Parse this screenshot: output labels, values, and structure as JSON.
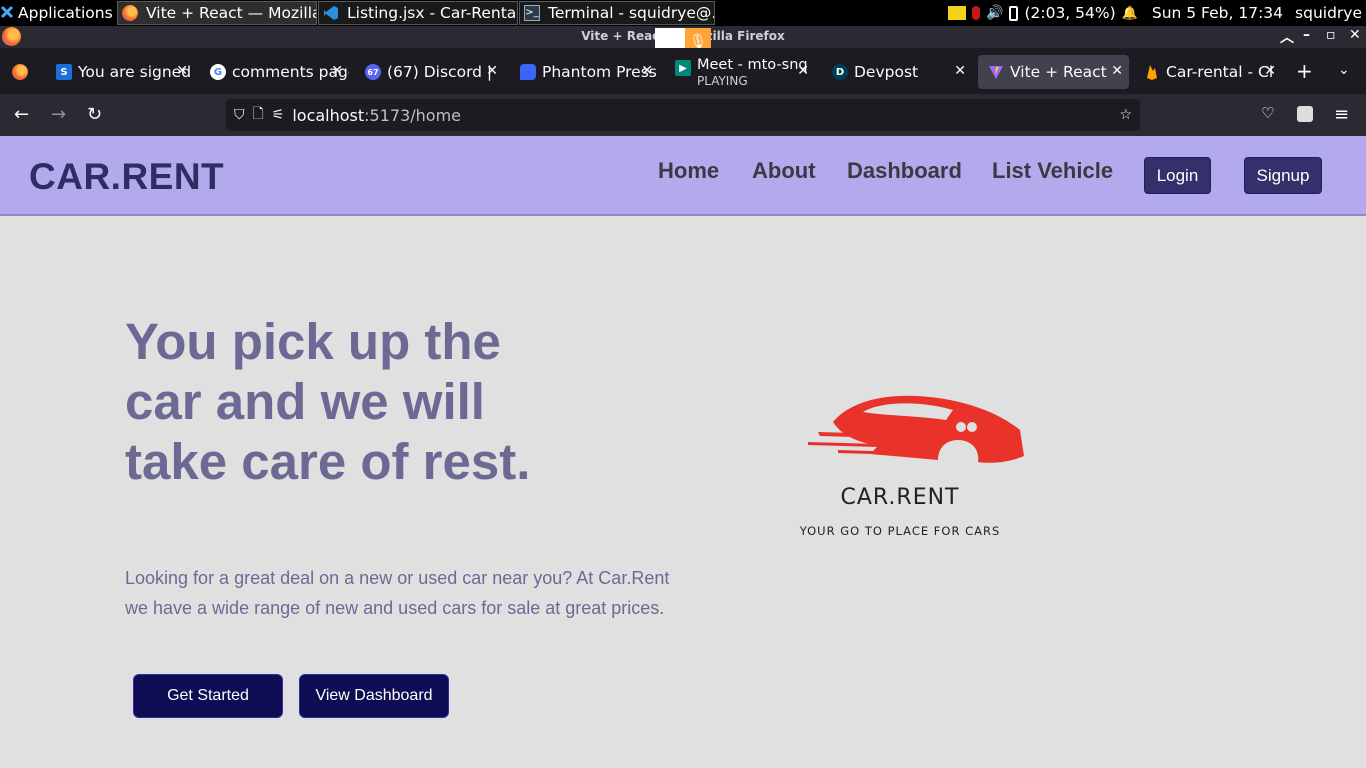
{
  "taskbar": {
    "apps_label": "Applications",
    "windows": [
      {
        "label": "Vite + React — Mozilla..."
      },
      {
        "label": "Listing.jsx - Car-Rental..."
      },
      {
        "label": "Terminal - squidrye@..."
      }
    ],
    "battery": "(2:03, 54%)",
    "clock": "Sun  5 Feb, 17:34",
    "user": "squidrye"
  },
  "browser": {
    "window_title": "Vite + React — Mozilla Firefox",
    "tabs": [
      {
        "label": "You are signed",
        "icon": "s-icon",
        "color": "#1b6fd8"
      },
      {
        "label": "comments page",
        "icon": "google-icon",
        "color": "#ffffff"
      },
      {
        "label": "(67) Discord |",
        "icon": "discord-icon",
        "color": "#5865f2"
      },
      {
        "label": "Phantom Press",
        "icon": "phantom-icon",
        "color": "#3b66f5"
      },
      {
        "label": "Meet - mto-snq",
        "sub": "PLAYING",
        "icon": "meet-icon",
        "color": "#00897b"
      },
      {
        "label": "Devpost",
        "icon": "devpost-icon",
        "color": "#003e54"
      },
      {
        "label": "Vite + React",
        "icon": "vite-icon",
        "color": "#9b6cff"
      },
      {
        "label": "Car-rental - Cl",
        "icon": "firebase-icon",
        "color": "#ffa000"
      }
    ],
    "url_host": "localhost",
    "url_path": ":5173/home"
  },
  "site": {
    "brand": "CAR.RENT",
    "nav": [
      "Home",
      "About",
      "Dashboard",
      "List Vehicle"
    ],
    "login_label": "Login",
    "signup_label": "Signup",
    "hero_title": "You pick up the car and we will take care of rest.",
    "hero_text": "Looking for a great deal on a new or used car near you? At Car.Rent we have a wide range of new and used cars for sale at great prices.",
    "get_started_label": "Get Started",
    "view_dashboard_label": "View Dashboard",
    "logo_name": "CAR.RENT",
    "logo_tagline": "YOUR GO TO PLACE FOR CARS",
    "accent": "#b3aaee",
    "logo_color": "#e8322a"
  }
}
